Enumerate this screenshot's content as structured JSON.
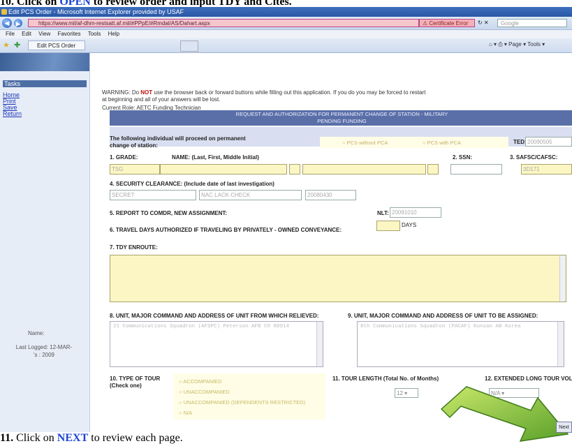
{
  "caption": {
    "top_prefix": "10. Click on",
    "top_link": "OPEN",
    "top_suffix": "to review order and input TDY and Cites.",
    "bottom_step": "11.",
    "bottom_prefix": "Click on",
    "bottom_link": "NEXT",
    "bottom_suffix": "to review each page."
  },
  "browser": {
    "window_title": "Edit PCS Order - Microsoft Internet Explorer provided by USAF",
    "url": "https://www.mil/af-dhm-restsatt.af.mil/#PPpE/#Rmdal/AS/Dahart.aspx",
    "cert_label": "Certificate Error",
    "search_placeholder": "Google",
    "menu": [
      "File",
      "Edit",
      "View",
      "Favorites",
      "Tools",
      "Help"
    ],
    "tab_label": "Edit PCS Order",
    "toolbar_right": "Page ▾   Tools ▾"
  },
  "sidebar": {
    "title": "Tasks",
    "links": [
      "Home",
      "Print",
      "Save",
      "Return"
    ],
    "name_label": "Name:",
    "login_label": "Last Logged: 12-MAR-",
    "login_date": "'s : 2009"
  },
  "warning": {
    "prefix": "WARNING: Do",
    "not": "NOT",
    "text": "use the browser back or forward buttons while filling out this application. If you do you may be forced to restart at beginning and all of your answers will be lost."
  },
  "role": "Current Role: AETC Funding Technician",
  "form": {
    "header_line1": "REQUEST AND AUTHORIZATION FOR PERMANENT CHANGE OF STATION - MILITARY",
    "header_line2": "PENDING FUNDING",
    "intro": "The following individual will proceed on permanent change of station:",
    "radio_without": "PCS without PCA",
    "radio_with": "PCS with PCA",
    "ted_label": "TED:",
    "ted_value": "20090505",
    "f1": "1. GRADE:",
    "f1_value": "TSG",
    "name_label": "NAME: (Last, First, Middle Initial)",
    "f2": "2. SSN:",
    "f3": "3. SAFSC/CAFSC:",
    "f3_value": "3D171",
    "f4": "4. SECURITY CLEARANCE: (Include date of last investigation)",
    "f4_v1": "SECRET",
    "f4_v2": "NAC LACK CHECK",
    "f4_v3": "20080430",
    "f5": "5. REPORT TO COMDR, NEW ASSIGNMENT:",
    "f5_nlt": "NLT:",
    "f5_value": "20091010",
    "f6": "6. TRAVEL DAYS AUTHORIZED IF TRAVELING BY PRIVATELY - OWNED CONVEYANCE:",
    "f6_unit": "DAYS",
    "f7": "7. TDY ENROUTE:",
    "f8": "8. UNIT, MAJOR COMMAND AND ADDRESS OF UNIT FROM WHICH RELIEVED:",
    "f8_value": "21 Communications Squadron (AFSPC) Peterson AFB CO 80914",
    "f9": "9. UNIT, MAJOR COMMAND AND ADDRESS OF UNIT TO BE ASSIGNED:",
    "f9_value": "8th Communications Squadron (PACAF) Kunsan AB Korea",
    "f10": "10. TYPE OF TOUR (Check one)",
    "f10_opts": [
      "ACCOMPANIED",
      "UNACCOMPANIED",
      "UNACCOMPANIED (DEPENDENTS RESTRICTED)",
      "N/A"
    ],
    "f11": "11. TOUR LENGTH (Total No. of Months)",
    "f11_value": "12",
    "f12": "12. EXTENDED LONG TOUR VOL",
    "f12_value": "N/A",
    "next": "Next"
  },
  "colors": {
    "accent": "#1a44d8",
    "form_header": "#5a6fa8",
    "input_yellow": "#fbf6c4",
    "arrow_green": "#8fc83a"
  }
}
